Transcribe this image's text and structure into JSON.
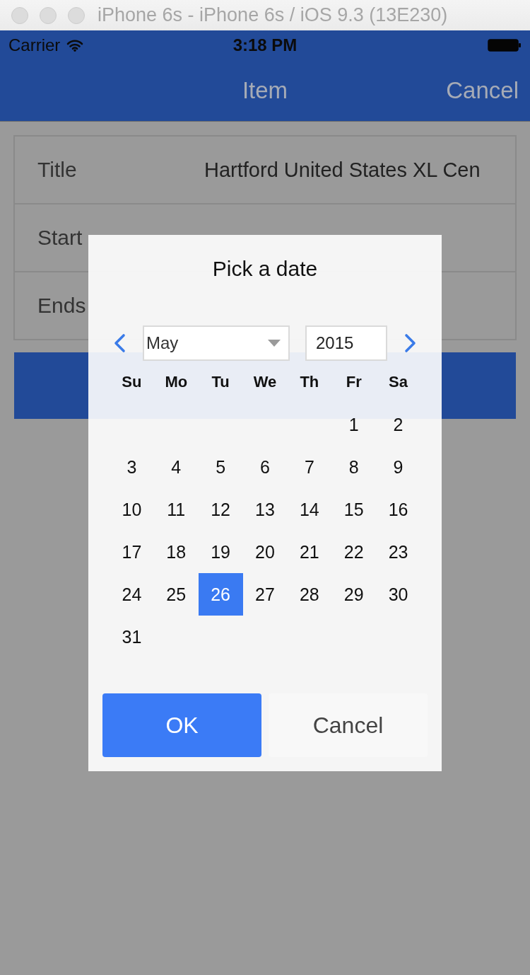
{
  "window": {
    "title": "iPhone 6s - iPhone 6s / iOS 9.3 (13E230)"
  },
  "status_bar": {
    "carrier": "Carrier",
    "time": "3:18 PM"
  },
  "nav_bar": {
    "title": "Item",
    "right_button": "Cancel"
  },
  "form": {
    "rows": [
      {
        "label": "Title",
        "value": "Hartford United States XL Cen"
      },
      {
        "label": "Start"
      },
      {
        "label": "Ends"
      }
    ]
  },
  "dialog": {
    "title": "Pick a date",
    "month": "May",
    "year": "2015",
    "weekdays": [
      "Su",
      "Mo",
      "Tu",
      "We",
      "Th",
      "Fr",
      "Sa"
    ],
    "weeks": [
      [
        {
          "label": "1",
          "selected": false
        },
        {
          "label": "2",
          "selected": false
        }
      ],
      [
        {
          "label": "3",
          "selected": false
        },
        {
          "label": "4",
          "selected": false
        },
        {
          "label": "5",
          "selected": false
        },
        {
          "label": "6",
          "selected": false
        },
        {
          "label": "7",
          "selected": false
        },
        {
          "label": "8",
          "selected": false
        },
        {
          "label": "9",
          "selected": false
        }
      ],
      [
        {
          "label": "10",
          "selected": false
        },
        {
          "label": "11",
          "selected": false
        },
        {
          "label": "12",
          "selected": false
        },
        {
          "label": "13",
          "selected": false
        },
        {
          "label": "14",
          "selected": false
        },
        {
          "label": "15",
          "selected": false
        },
        {
          "label": "16",
          "selected": false
        }
      ],
      [
        {
          "label": "17",
          "selected": false
        },
        {
          "label": "18",
          "selected": false
        },
        {
          "label": "19",
          "selected": false
        },
        {
          "label": "20",
          "selected": false
        },
        {
          "label": "21",
          "selected": false
        },
        {
          "label": "22",
          "selected": false
        },
        {
          "label": "23",
          "selected": false
        }
      ],
      [
        {
          "label": "24",
          "selected": false
        },
        {
          "label": "25",
          "selected": false
        },
        {
          "label": "26",
          "selected": true
        },
        {
          "label": "27",
          "selected": false
        },
        {
          "label": "28",
          "selected": false
        },
        {
          "label": "29",
          "selected": false
        },
        {
          "label": "30",
          "selected": false
        }
      ],
      [
        {
          "label": "31",
          "selected": false
        }
      ]
    ],
    "ok_button": "OK",
    "cancel_button": "Cancel"
  }
}
